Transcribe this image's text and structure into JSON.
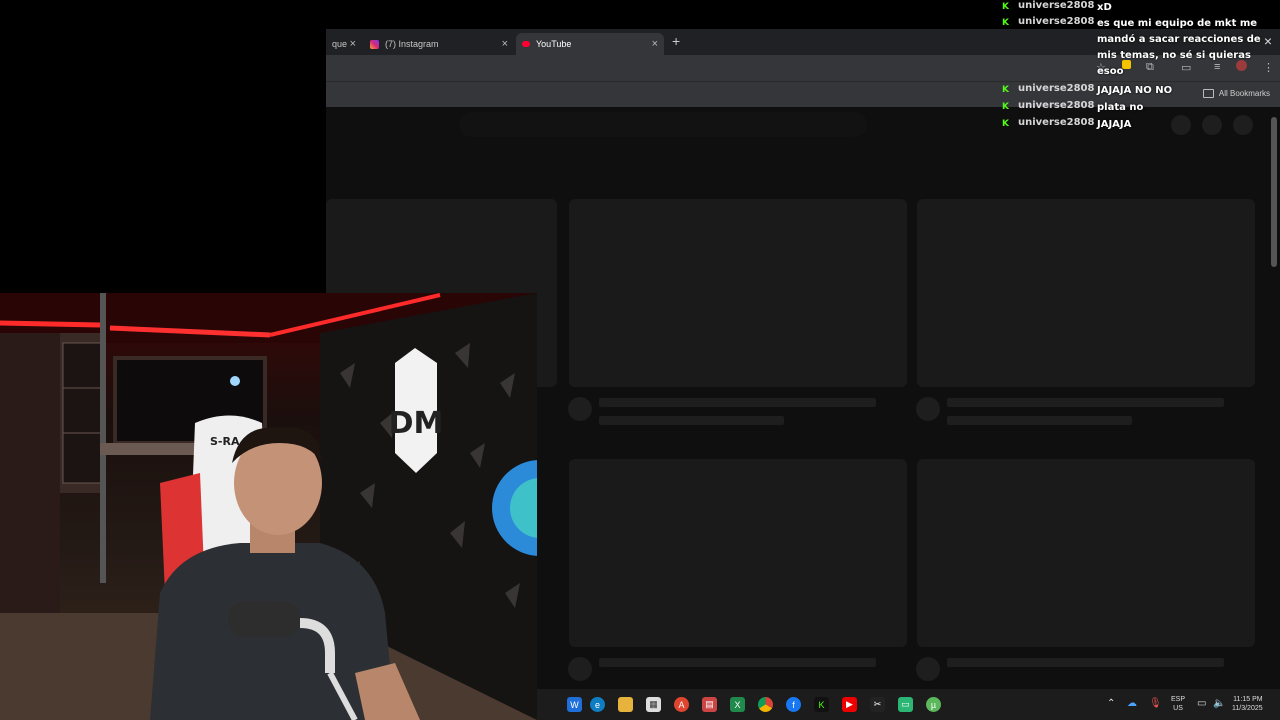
{
  "browser": {
    "tabs": [
      {
        "label": "que",
        "active": false
      },
      {
        "label": "(7) Instagram",
        "active": false
      },
      {
        "label": "YouTube",
        "active": true
      }
    ],
    "bookmarks_label": "All Bookmarks"
  },
  "chat": {
    "messages": [
      {
        "user": "universe2808",
        "text": "xD"
      },
      {
        "user": "universe2808",
        "text": "es que mi equipo de mkt me mandó a sacar reacciones de mis temas, no sé si quieras esoo"
      },
      {
        "user": "universe2808",
        "text": "JAJAJA NO NO"
      },
      {
        "user": "universe2808",
        "text": "plata no"
      },
      {
        "user": "universe2808",
        "text": "JAJAJA"
      }
    ]
  },
  "webcam": {
    "logo_text": "DM",
    "chair_text": "S-RA"
  },
  "taskbar": {
    "lang_top": "ESP",
    "lang_bottom": "US",
    "time": "11:15 PM",
    "date": "11/3/2025"
  },
  "colors": {
    "kick_green": "#53fc18",
    "browser_chrome": "#35363a",
    "page_bg": "#0f0f0f",
    "led_red": "#ff2a2a"
  }
}
